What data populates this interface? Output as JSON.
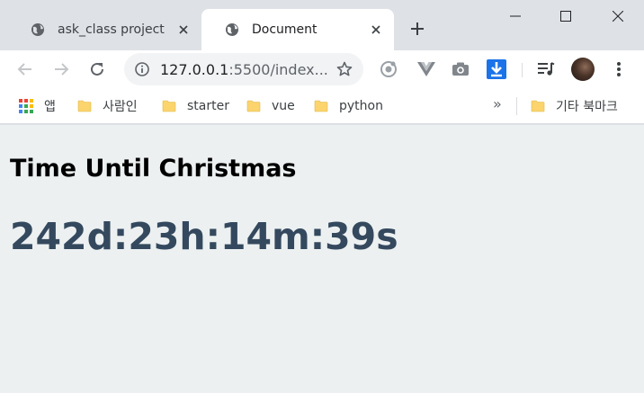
{
  "tabs": [
    {
      "label": "ask_class project",
      "active": false
    },
    {
      "label": "Document",
      "active": true
    }
  ],
  "address_bar": {
    "host": "127.0.0.1",
    "rest": ":5500/index..."
  },
  "bookmarks": {
    "apps_label": "앱",
    "items": [
      {
        "label": "사람인"
      },
      {
        "label": "starter"
      },
      {
        "label": "vue"
      },
      {
        "label": "python"
      }
    ],
    "overflow": "»",
    "other_label": "기타 북마크"
  },
  "page": {
    "heading": "Time Until Christmas",
    "countdown": "242d:23h:14m:39s"
  },
  "colors": {
    "tab_strip": "#dee1e6",
    "page_background": "#ecf0f1",
    "countdown_text": "#34495e",
    "folder": "#fbd46d",
    "download_ext": "#1a73e8"
  },
  "icons": {
    "tab_favicon": "globe-icon",
    "tab_close": "close-icon",
    "new_tab": "plus-icon",
    "back": "arrow-left-icon",
    "forward": "arrow-right-icon",
    "reload": "reload-icon",
    "site_info": "info-icon",
    "bookmark_star": "star-icon",
    "menu": "kebab-menu-icon"
  }
}
